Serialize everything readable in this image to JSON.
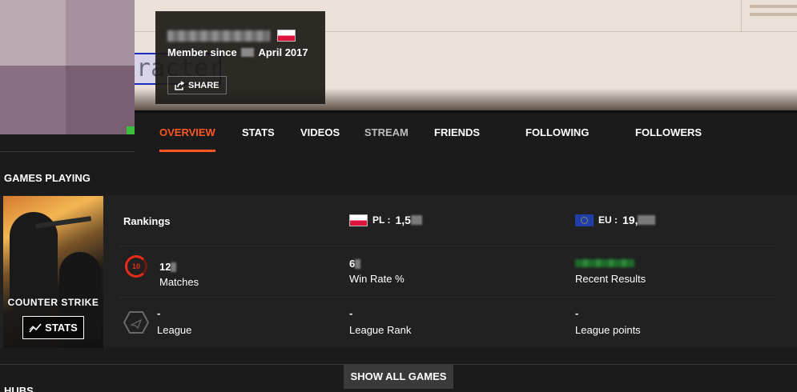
{
  "banner": {
    "partial_text": "racter"
  },
  "profile": {
    "member_since": "Member since",
    "member_since_month_year": "April 2017",
    "share_label": "SHARE"
  },
  "nav": {
    "tabs": [
      {
        "label": "OVERVIEW",
        "active": true
      },
      {
        "label": "STATS"
      },
      {
        "label": "VIDEOS"
      },
      {
        "label": "STREAM"
      },
      {
        "label": "FRIENDS"
      },
      {
        "label": "FOLLOWING"
      },
      {
        "label": "FOLLOWERS"
      }
    ]
  },
  "games": {
    "section_title": "GAMES PLAYING",
    "game": {
      "logo_text": "COUNTER STRIKE",
      "stats_button": "STATS",
      "rankings_label": "Rankings",
      "pl_rank": {
        "label": "PL :",
        "value": "1,5"
      },
      "eu_rank": {
        "label": "EU :",
        "value": "19,"
      },
      "level": "10",
      "matches": {
        "value": "12",
        "label": "Matches"
      },
      "win_rate": {
        "value": "6",
        "label": "Win Rate %"
      },
      "recent_results": {
        "label": "Recent Results"
      },
      "league": {
        "value": "-",
        "label": "League"
      },
      "league_rank": {
        "value": "-",
        "label": "League Rank"
      },
      "league_points": {
        "value": "-",
        "label": "League points"
      }
    },
    "show_all": "SHOW ALL GAMES"
  },
  "colors": {
    "accent": "#ff5722",
    "background": "#1b1b1b",
    "panel": "#212121"
  }
}
